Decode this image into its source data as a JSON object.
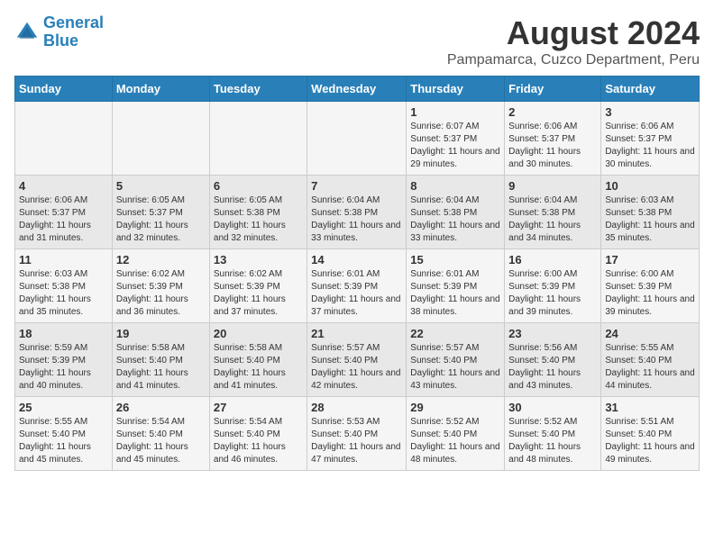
{
  "header": {
    "logo_line1": "General",
    "logo_line2": "Blue",
    "title": "August 2024",
    "subtitle": "Pampamarca, Cuzco Department, Peru"
  },
  "days_of_week": [
    "Sunday",
    "Monday",
    "Tuesday",
    "Wednesday",
    "Thursday",
    "Friday",
    "Saturday"
  ],
  "weeks": [
    [
      {
        "day": "",
        "info": ""
      },
      {
        "day": "",
        "info": ""
      },
      {
        "day": "",
        "info": ""
      },
      {
        "day": "",
        "info": ""
      },
      {
        "day": "1",
        "info": "Sunrise: 6:07 AM\nSunset: 5:37 PM\nDaylight: 11 hours and 29 minutes."
      },
      {
        "day": "2",
        "info": "Sunrise: 6:06 AM\nSunset: 5:37 PM\nDaylight: 11 hours and 30 minutes."
      },
      {
        "day": "3",
        "info": "Sunrise: 6:06 AM\nSunset: 5:37 PM\nDaylight: 11 hours and 30 minutes."
      }
    ],
    [
      {
        "day": "4",
        "info": "Sunrise: 6:06 AM\nSunset: 5:37 PM\nDaylight: 11 hours and 31 minutes."
      },
      {
        "day": "5",
        "info": "Sunrise: 6:05 AM\nSunset: 5:37 PM\nDaylight: 11 hours and 32 minutes."
      },
      {
        "day": "6",
        "info": "Sunrise: 6:05 AM\nSunset: 5:38 PM\nDaylight: 11 hours and 32 minutes."
      },
      {
        "day": "7",
        "info": "Sunrise: 6:04 AM\nSunset: 5:38 PM\nDaylight: 11 hours and 33 minutes."
      },
      {
        "day": "8",
        "info": "Sunrise: 6:04 AM\nSunset: 5:38 PM\nDaylight: 11 hours and 33 minutes."
      },
      {
        "day": "9",
        "info": "Sunrise: 6:04 AM\nSunset: 5:38 PM\nDaylight: 11 hours and 34 minutes."
      },
      {
        "day": "10",
        "info": "Sunrise: 6:03 AM\nSunset: 5:38 PM\nDaylight: 11 hours and 35 minutes."
      }
    ],
    [
      {
        "day": "11",
        "info": "Sunrise: 6:03 AM\nSunset: 5:38 PM\nDaylight: 11 hours and 35 minutes."
      },
      {
        "day": "12",
        "info": "Sunrise: 6:02 AM\nSunset: 5:39 PM\nDaylight: 11 hours and 36 minutes."
      },
      {
        "day": "13",
        "info": "Sunrise: 6:02 AM\nSunset: 5:39 PM\nDaylight: 11 hours and 37 minutes."
      },
      {
        "day": "14",
        "info": "Sunrise: 6:01 AM\nSunset: 5:39 PM\nDaylight: 11 hours and 37 minutes."
      },
      {
        "day": "15",
        "info": "Sunrise: 6:01 AM\nSunset: 5:39 PM\nDaylight: 11 hours and 38 minutes."
      },
      {
        "day": "16",
        "info": "Sunrise: 6:00 AM\nSunset: 5:39 PM\nDaylight: 11 hours and 39 minutes."
      },
      {
        "day": "17",
        "info": "Sunrise: 6:00 AM\nSunset: 5:39 PM\nDaylight: 11 hours and 39 minutes."
      }
    ],
    [
      {
        "day": "18",
        "info": "Sunrise: 5:59 AM\nSunset: 5:39 PM\nDaylight: 11 hours and 40 minutes."
      },
      {
        "day": "19",
        "info": "Sunrise: 5:58 AM\nSunset: 5:40 PM\nDaylight: 11 hours and 41 minutes."
      },
      {
        "day": "20",
        "info": "Sunrise: 5:58 AM\nSunset: 5:40 PM\nDaylight: 11 hours and 41 minutes."
      },
      {
        "day": "21",
        "info": "Sunrise: 5:57 AM\nSunset: 5:40 PM\nDaylight: 11 hours and 42 minutes."
      },
      {
        "day": "22",
        "info": "Sunrise: 5:57 AM\nSunset: 5:40 PM\nDaylight: 11 hours and 43 minutes."
      },
      {
        "day": "23",
        "info": "Sunrise: 5:56 AM\nSunset: 5:40 PM\nDaylight: 11 hours and 43 minutes."
      },
      {
        "day": "24",
        "info": "Sunrise: 5:55 AM\nSunset: 5:40 PM\nDaylight: 11 hours and 44 minutes."
      }
    ],
    [
      {
        "day": "25",
        "info": "Sunrise: 5:55 AM\nSunset: 5:40 PM\nDaylight: 11 hours and 45 minutes."
      },
      {
        "day": "26",
        "info": "Sunrise: 5:54 AM\nSunset: 5:40 PM\nDaylight: 11 hours and 45 minutes."
      },
      {
        "day": "27",
        "info": "Sunrise: 5:54 AM\nSunset: 5:40 PM\nDaylight: 11 hours and 46 minutes."
      },
      {
        "day": "28",
        "info": "Sunrise: 5:53 AM\nSunset: 5:40 PM\nDaylight: 11 hours and 47 minutes."
      },
      {
        "day": "29",
        "info": "Sunrise: 5:52 AM\nSunset: 5:40 PM\nDaylight: 11 hours and 48 minutes."
      },
      {
        "day": "30",
        "info": "Sunrise: 5:52 AM\nSunset: 5:40 PM\nDaylight: 11 hours and 48 minutes."
      },
      {
        "day": "31",
        "info": "Sunrise: 5:51 AM\nSunset: 5:40 PM\nDaylight: 11 hours and 49 minutes."
      }
    ]
  ]
}
